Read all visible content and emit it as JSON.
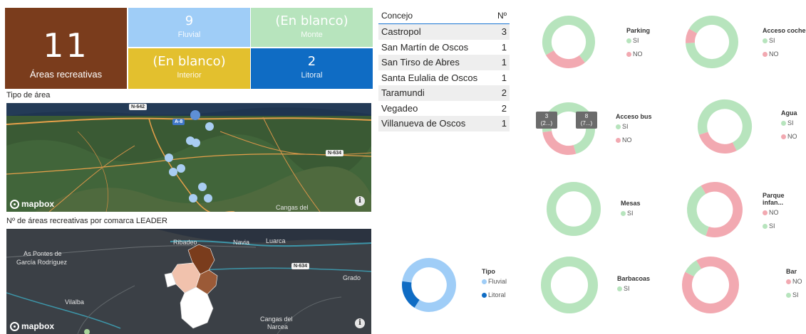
{
  "kpis": {
    "total": {
      "value": "11",
      "label": "Áreas recreativas",
      "color": "#7a3c1c"
    },
    "fluvial": {
      "value": "9",
      "label": "Fluvial",
      "color": "#9fcdf7"
    },
    "monte": {
      "value": "(En blanco)",
      "label": "Monte",
      "color": "#b7e4bd"
    },
    "interior": {
      "value": "(En blanco)",
      "label": "Interior",
      "color": "#e3c02e"
    },
    "litoral": {
      "value": "2",
      "label": "Litoral",
      "color": "#0f6cc4"
    }
  },
  "map_tipo": {
    "title": "Tipo de área",
    "labels": {
      "n642": "N-642",
      "a8": "A-8",
      "n634": "N-634",
      "cangas": "Cangas del"
    },
    "mapbox": "mapbox",
    "info": "i"
  },
  "map_leader": {
    "title": "Nº de áreas recreativas por comarca LEADER",
    "labels": {
      "pontes": "As Pontes de",
      "garcia": "García Rodríguez",
      "ribadeo": "Ribadeo",
      "navia": "Navia",
      "luarca": "Luarca",
      "n634": "N-634",
      "grado": "Grado",
      "vilalba": "Vilalba",
      "cangas1": "Cangas del",
      "cangas2": "Narcea"
    },
    "mapbox": "mapbox",
    "info": "i"
  },
  "table": {
    "headers": {
      "name": "Concejo",
      "count": "Nº"
    },
    "rows": [
      {
        "name": "Castropol",
        "count": "3"
      },
      {
        "name": "San Martín de Oscos",
        "count": "1"
      },
      {
        "name": "San Tirso de Abres",
        "count": "1"
      },
      {
        "name": "Santa Eulalia de Oscos",
        "count": "1"
      },
      {
        "name": "Taramundi",
        "count": "2"
      },
      {
        "name": "Vegadeo",
        "count": "2"
      },
      {
        "name": "Villanueva de Oscos",
        "count": "1"
      }
    ]
  },
  "colors": {
    "si": "#b7e4bd",
    "no": "#f2a9b1",
    "fluvial": "#9fcdf7",
    "litoral": "#0f6cc4"
  },
  "donuts": {
    "parking": {
      "title": "Parking",
      "legend": [
        "SI",
        "NO"
      ]
    },
    "acceso_coche": {
      "title": "Acceso coche",
      "legend": [
        "SI",
        "NO"
      ]
    },
    "acceso_bus": {
      "title": "Acceso bus",
      "legend": [
        "SI",
        "NO"
      ],
      "tooltip_no": "3\n(2...)",
      "tooltip_si": "8\n(7...)",
      "tip_no_l1": "3",
      "tip_no_l2": "(2...)",
      "tip_si_l1": "8",
      "tip_si_l2": "(7...)"
    },
    "agua": {
      "title": "Agua",
      "legend": [
        "SI",
        "NO"
      ]
    },
    "mesas": {
      "title": "Mesas",
      "legend": [
        "SI"
      ]
    },
    "parque": {
      "title": "Parque infan...",
      "legend": [
        "NO",
        "SI"
      ]
    },
    "tipo": {
      "title": "Tipo",
      "legend": [
        "Fluvial",
        "Litoral"
      ]
    },
    "barbacoas": {
      "title": "Barbacoas",
      "legend": [
        "SI"
      ]
    },
    "bar": {
      "title": "Bar",
      "legend": [
        "NO",
        "SI"
      ]
    }
  },
  "chart_data": [
    {
      "type": "pie",
      "title": "Parking",
      "categories": [
        "SI",
        "NO"
      ],
      "values": [
        8,
        3
      ]
    },
    {
      "type": "pie",
      "title": "Acceso coche",
      "categories": [
        "SI",
        "NO"
      ],
      "values": [
        10,
        1
      ]
    },
    {
      "type": "pie",
      "title": "Acceso bus",
      "categories": [
        "SI",
        "NO"
      ],
      "values": [
        8,
        3
      ]
    },
    {
      "type": "pie",
      "title": "Agua",
      "categories": [
        "SI",
        "NO"
      ],
      "values": [
        8,
        3
      ]
    },
    {
      "type": "pie",
      "title": "Mesas",
      "categories": [
        "SI"
      ],
      "values": [
        11
      ]
    },
    {
      "type": "pie",
      "title": "Parque infan...",
      "categories": [
        "NO",
        "SI"
      ],
      "values": [
        7,
        4
      ]
    },
    {
      "type": "pie",
      "title": "Tipo",
      "categories": [
        "Fluvial",
        "Litoral"
      ],
      "values": [
        9,
        2
      ]
    },
    {
      "type": "pie",
      "title": "Barbacoas",
      "categories": [
        "SI"
      ],
      "values": [
        11
      ]
    },
    {
      "type": "pie",
      "title": "Bar",
      "categories": [
        "NO",
        "SI"
      ],
      "values": [
        10,
        1
      ]
    }
  ]
}
